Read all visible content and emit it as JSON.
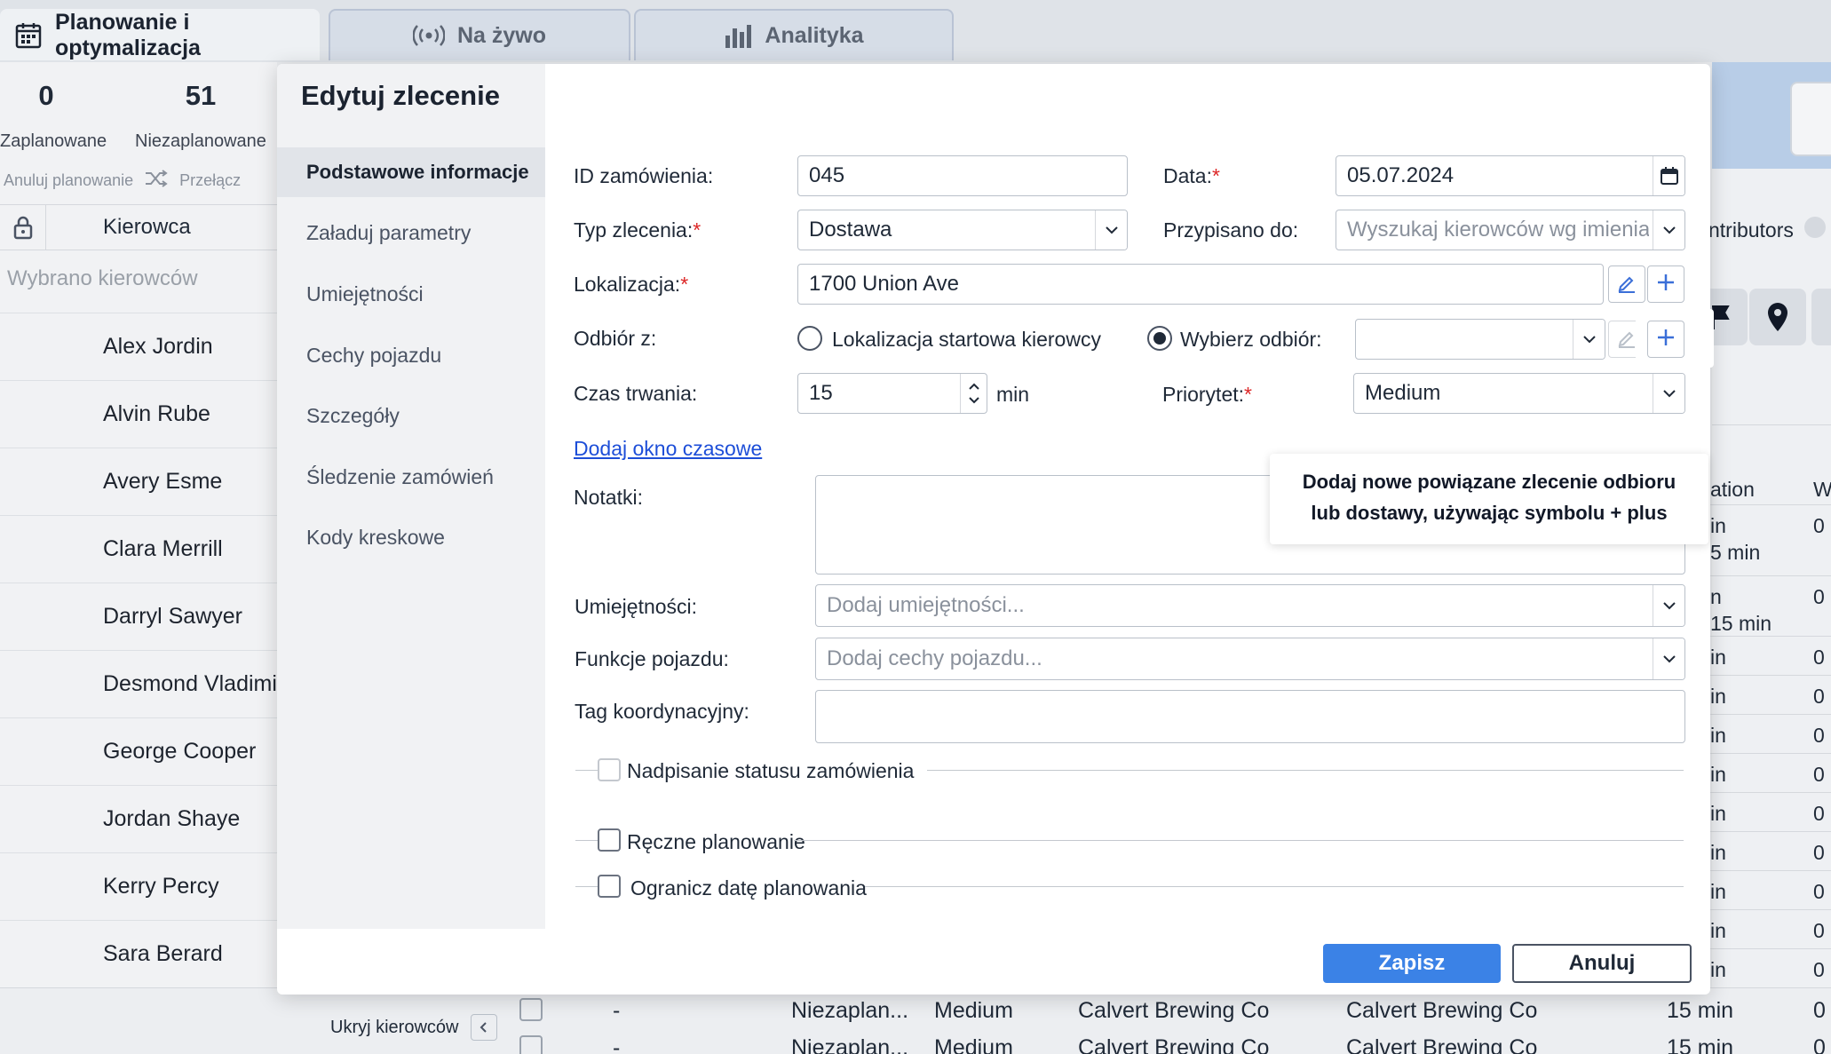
{
  "tabs": [
    {
      "label": "Planowanie i optymalizacja",
      "icon": "calendar-icon"
    },
    {
      "label": "Na żywo",
      "icon": "broadcast-icon"
    },
    {
      "label": "Analityka",
      "icon": "bar-chart-icon"
    }
  ],
  "stats": [
    {
      "value": "0",
      "label": "Zaplanowane"
    },
    {
      "value": "51",
      "label": "Niezaplanowane"
    }
  ],
  "actions": {
    "cancel_planning": "Anuluj planowanie",
    "switch": "Przełącz"
  },
  "drivers_table": {
    "column": "Kierowca",
    "selected_placeholder": "Wybrano kierowców",
    "drivers": [
      "Alex Jordin",
      "Alvin Rube",
      "Avery Esme",
      "Clara Merrill",
      "Darryl Sawyer",
      "Desmond Vladimir",
      "George Cooper",
      "Jordan Shaye",
      "Kerry Percy",
      "Sara Berard"
    ]
  },
  "hide_drivers": "Ukryj kierowców",
  "right_panel": {
    "contributors": "ntributors",
    "header_a": "ation",
    "header_b": "W",
    "rows": [
      {
        "a": "in",
        "a2": "5 min",
        "b": "0"
      },
      {
        "a": "n",
        "a2": "15 min",
        "b": "0"
      },
      {
        "a": "in",
        "b": "0"
      },
      {
        "a": "in",
        "b": "0"
      },
      {
        "a": "in",
        "b": "0"
      },
      {
        "a": "in",
        "b": "0"
      },
      {
        "a": "in",
        "b": "0"
      },
      {
        "a": "in",
        "b": "0"
      },
      {
        "a": "in",
        "b": "0"
      },
      {
        "a": "in",
        "b": "0"
      },
      {
        "a": "in",
        "b": "0"
      }
    ]
  },
  "bottom_rows": [
    {
      "c1": "-",
      "c2": "Niezaplan...",
      "c3": "Medium",
      "c4": "Calvert Brewing Co",
      "c5": "Calvert Brewing Co",
      "c6": "15 min",
      "c7": "0"
    },
    {
      "c1": "-",
      "c2": "Niezaplan...",
      "c3": "Medium",
      "c4": "Calvert Brewing Co",
      "c5": "Calvert Brewing Co",
      "c6": "15 min",
      "c7": "0"
    }
  ],
  "modal": {
    "title": "Edytuj zlecenie",
    "nav": [
      "Podstawowe informacje",
      "Załaduj parametry",
      "Umiejętności",
      "Cechy pojazdu",
      "Szczegóły",
      "Śledzenie zamówień",
      "Kody kreskowe"
    ],
    "fields": {
      "order_id": {
        "label": "ID zamówienia:",
        "value": "045"
      },
      "date": {
        "label": "Data:",
        "value": "05.07.2024"
      },
      "order_type": {
        "label": "Typ zlecenia:",
        "value": "Dostawa"
      },
      "assigned_to": {
        "label": "Przypisano do:",
        "placeholder": "Wyszukaj kierowców wg imienia lub na"
      },
      "location": {
        "label": "Lokalizacja:",
        "value": "1700 Union Ave"
      },
      "pickup_from": {
        "label": "Odbiór z:",
        "option1": "Lokalizacja startowa kierowcy",
        "option2": "Wybierz odbiór:"
      },
      "duration": {
        "label": "Czas trwania:",
        "value": "15",
        "unit": "min"
      },
      "priority": {
        "label": "Priorytet:",
        "value": "Medium"
      },
      "time_window_link": "Dodaj okno czasowe",
      "notes": {
        "label": "Notatki:"
      },
      "skills": {
        "label": "Umiejętności:",
        "placeholder": "Dodaj umiejętności..."
      },
      "vehicle_features": {
        "label": "Funkcje pojazdu:",
        "placeholder": "Dodaj cechy pojazdu..."
      },
      "coordination_tag": {
        "label": "Tag koordynacyjny:"
      },
      "status_override": "Nadpisanie statusu zamówienia",
      "manual_planning": "Ręczne planowanie",
      "limit_planning_date": "Ogranicz datę planowania"
    },
    "tooltip": {
      "line1": "Dodaj nowe powiązane zlecenie odbioru",
      "line2": "lub dostawy, używając symbolu + plus"
    },
    "save": "Zapisz",
    "cancel": "Anuluj"
  },
  "colors": {
    "accent": "#3b82e6",
    "required": "#dc2626",
    "link": "#1d4ed8"
  }
}
